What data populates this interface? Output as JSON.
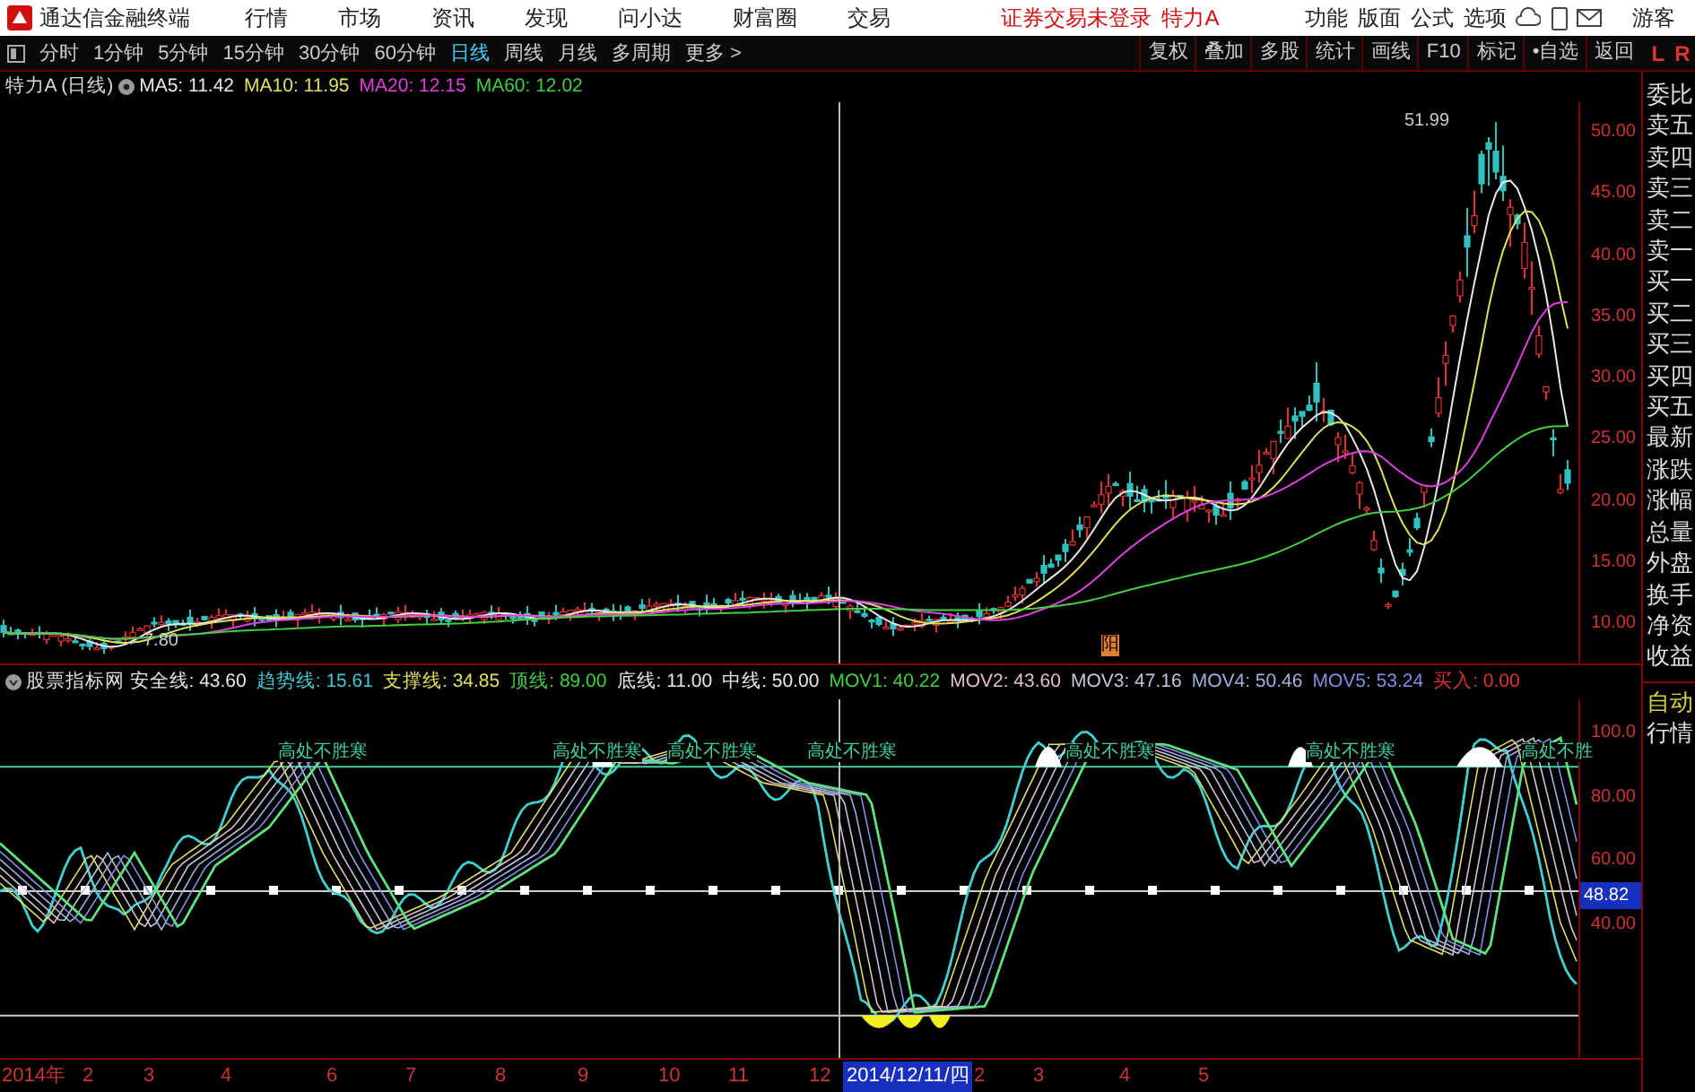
{
  "title_bar": {
    "app_name": "通达信金融终端",
    "menus": [
      "行情",
      "市场",
      "资讯",
      "发现",
      "问小达",
      "财富圈",
      "交易"
    ],
    "login_notice": "证券交易未登录",
    "stock_name": "特力A",
    "tools": [
      "功能",
      "版面",
      "公式",
      "选项"
    ],
    "user": "游客"
  },
  "toolbar": {
    "periods": [
      {
        "label": "分时",
        "selected": false
      },
      {
        "label": "1分钟",
        "selected": false
      },
      {
        "label": "5分钟",
        "selected": false
      },
      {
        "label": "15分钟",
        "selected": false
      },
      {
        "label": "30分钟",
        "selected": false
      },
      {
        "label": "60分钟",
        "selected": false
      },
      {
        "label": "日线",
        "selected": true
      },
      {
        "label": "周线",
        "selected": false
      },
      {
        "label": "月线",
        "selected": false
      },
      {
        "label": "多周期",
        "selected": false
      },
      {
        "label": "更多 >",
        "selected": false
      }
    ],
    "actions": [
      "复权",
      "叠加",
      "多股",
      "统计",
      "画线",
      "F10",
      "标记",
      "•自选",
      "返回"
    ],
    "left_marker": "L",
    "right_marker": "R"
  },
  "price_chart": {
    "title": "特力A (日线)",
    "ma": [
      {
        "label": "MA5: 11.42",
        "color": "#e8e8e8"
      },
      {
        "label": "MA10: 11.95",
        "color": "#e0e060"
      },
      {
        "label": "MA20: 12.15",
        "color": "#e040e0"
      },
      {
        "label": "MA60: 12.02",
        "color": "#40d040"
      }
    ],
    "y_axis": [
      "50.00",
      "45.00",
      "40.00",
      "35.00",
      "30.00",
      "25.00",
      "20.00",
      "15.00",
      "10.00"
    ],
    "high_label": "51.99",
    "low_label": "←7.80",
    "marker": "阳"
  },
  "quote_panel": {
    "items": [
      "委比",
      "卖五",
      "卖四",
      "卖三",
      "卖二",
      "卖一",
      "买一",
      "买二",
      "买三",
      "买四",
      "买五",
      "最新",
      "涨跌",
      "涨幅",
      "总量",
      "外盘",
      "换手",
      "净资",
      "收益"
    ]
  },
  "indicator": {
    "name": "股票指标网",
    "values": [
      {
        "label": "安全线:",
        "value": "43.60",
        "color": "#e8e8e8"
      },
      {
        "label": "趋势线:",
        "value": "15.61",
        "color": "#40c8d8"
      },
      {
        "label": "支撑线:",
        "value": "34.85",
        "color": "#e0e060"
      },
      {
        "label": "顶线:",
        "value": "89.00",
        "color": "#40d040"
      },
      {
        "label": "底线:",
        "value": "11.00",
        "color": "#e8e8e8"
      },
      {
        "label": "中线:",
        "value": "50.00",
        "color": "#e8e8e8"
      },
      {
        "label": "MOV1:",
        "value": "40.22",
        "color": "#40d040"
      },
      {
        "label": "MOV2:",
        "value": "43.60",
        "color": "#e0c0c0"
      },
      {
        "label": "MOV3:",
        "value": "47.16",
        "color": "#c0c8e0"
      },
      {
        "label": "MOV4:",
        "value": "50.46",
        "color": "#a0b0e0"
      },
      {
        "label": "MOV5:",
        "value": "53.24",
        "color": "#8090e0"
      },
      {
        "label": "买入:",
        "value": "0.00",
        "color": "#e03030"
      }
    ],
    "alerts": [
      "高处不胜寒",
      "高处不胜寒",
      "高处不胜寒",
      "高处不胜寒",
      "高处不胜寒",
      "高处不胜寒",
      "高处不胜"
    ],
    "y_axis": [
      "100.0",
      "80.00",
      "60.00",
      "40.00"
    ],
    "current": "48.82",
    "side_items": [
      "自动",
      "行情"
    ]
  },
  "time_axis": {
    "labels": [
      {
        "text": "2014年",
        "selected": false
      },
      {
        "text": "2",
        "selected": false
      },
      {
        "text": "3",
        "selected": false
      },
      {
        "text": "4",
        "selected": false
      },
      {
        "text": "6",
        "selected": false
      },
      {
        "text": "7",
        "selected": false
      },
      {
        "text": "8",
        "selected": false
      },
      {
        "text": "9",
        "selected": false
      },
      {
        "text": "10",
        "selected": false
      },
      {
        "text": "11",
        "selected": false
      },
      {
        "text": "12",
        "selected": false
      },
      {
        "text": "2014/12/11/四",
        "selected": true
      },
      {
        "text": "2",
        "selected": false
      },
      {
        "text": "3",
        "selected": false
      },
      {
        "text": "4",
        "selected": false
      },
      {
        "text": "5",
        "selected": false
      }
    ]
  }
}
